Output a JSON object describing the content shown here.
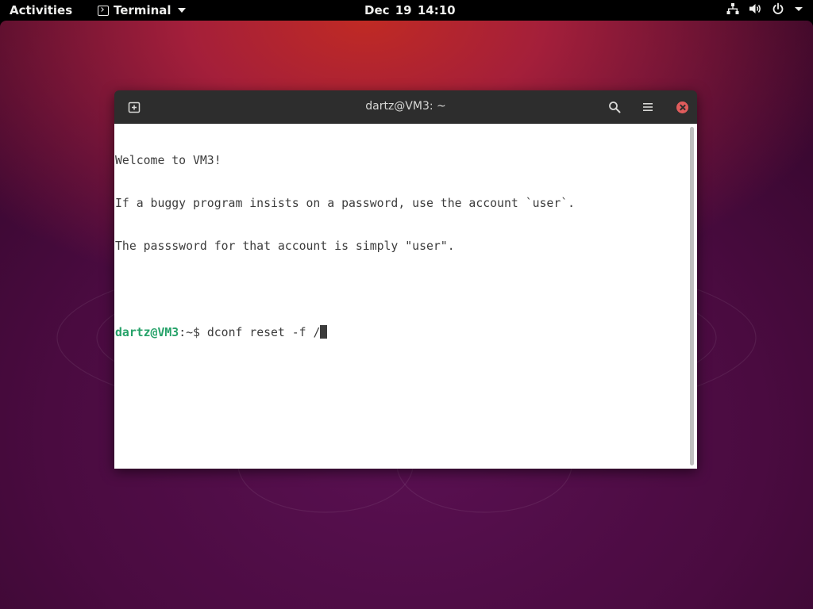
{
  "topbar": {
    "activities_label": "Activities",
    "app_menu_label": "Terminal",
    "clock": "Dec 19  14:10",
    "icons": [
      "network-icon",
      "volume-icon",
      "power-icon",
      "chevron-down-icon"
    ]
  },
  "window": {
    "title": "dartz@VM3: ~",
    "buttons": {
      "new_tab": "new-tab-icon",
      "search": "search-icon",
      "menu": "hamburger-menu-icon",
      "close": "close-icon"
    }
  },
  "terminal": {
    "lines": [
      "Welcome to VM3!",
      "If a buggy program insists on a password, use the account `user`.",
      "The passsword for that account is simply \"user\".",
      ""
    ],
    "prompt": {
      "user_host": "dartz@VM3",
      "path": ":~",
      "symbol": "$ ",
      "command": "dconf reset -f /"
    }
  },
  "colors": {
    "prompt_user": "#26a269",
    "headerbar": "#2d2d2d",
    "close_button": "#e05c5c",
    "wallpaper_top": "#c02a24",
    "wallpaper_bottom": "#2c0524"
  }
}
